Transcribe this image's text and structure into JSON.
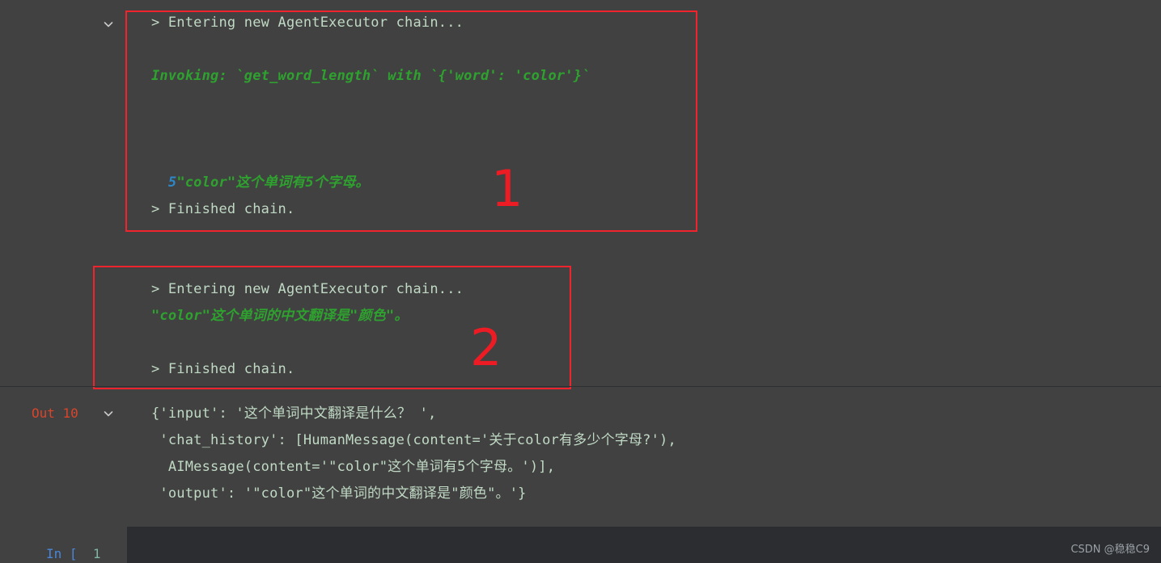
{
  "theme": {
    "background": "#414141",
    "input_cell_background": "#2b2d30",
    "rule_color": "#2e2f31",
    "annotation_red": "#ed1c24",
    "stream_text": "#c0d9c4",
    "agent_green": "#2ea12f",
    "tool_result_blue": "#2f86c5",
    "out_prompt_color": "#d9452b",
    "in_prompt_color": "#4a86d8"
  },
  "cell_one": {
    "chevron_icon": "chevron-down-icon",
    "annotation_label": "1",
    "lines": [
      {
        "id": "entering",
        "text": "> Entering new AgentExecutor chain...",
        "style": "plain"
      },
      {
        "id": "invoking",
        "text": "Invoking: `get_word_length` with `{'word': 'color'}`",
        "style": "green"
      },
      {
        "id": "tool-result-prefix",
        "text": "5",
        "style": "blue"
      },
      {
        "id": "tool-answer",
        "text": "\"color\"这个单词有5个字母。",
        "style": "green"
      },
      {
        "id": "finished",
        "text": "> Finished chain.",
        "style": "plain"
      }
    ]
  },
  "cell_two": {
    "annotation_label": "2",
    "lines": [
      {
        "id": "entering",
        "text": "> Entering new AgentExecutor chain...",
        "style": "plain"
      },
      {
        "id": "answer",
        "text": "\"color\"这个单词的中文翻译是\"颜色\"。",
        "style": "green"
      },
      {
        "id": "finished",
        "text": "> Finished chain.",
        "style": "plain"
      }
    ]
  },
  "output": {
    "prompt_label": "Out 10",
    "chevron_icon": "chevron-down-icon",
    "lines": [
      "{'input': '这个单词中文翻译是什么？ ',",
      " 'chat_history': [HumanMessage(content='关于color有多少个字母?'),",
      "  AIMessage(content='\"color\"这个单词有5个字母。')],",
      " 'output': '\"color\"这个单词的中文翻译是\"颜色\"。'}"
    ]
  },
  "input_cell": {
    "prompt_prefix": "In",
    "prompt_bracket": "[",
    "prompt_number": "1"
  },
  "watermark": {
    "text": "CSDN @稳稳C9"
  }
}
